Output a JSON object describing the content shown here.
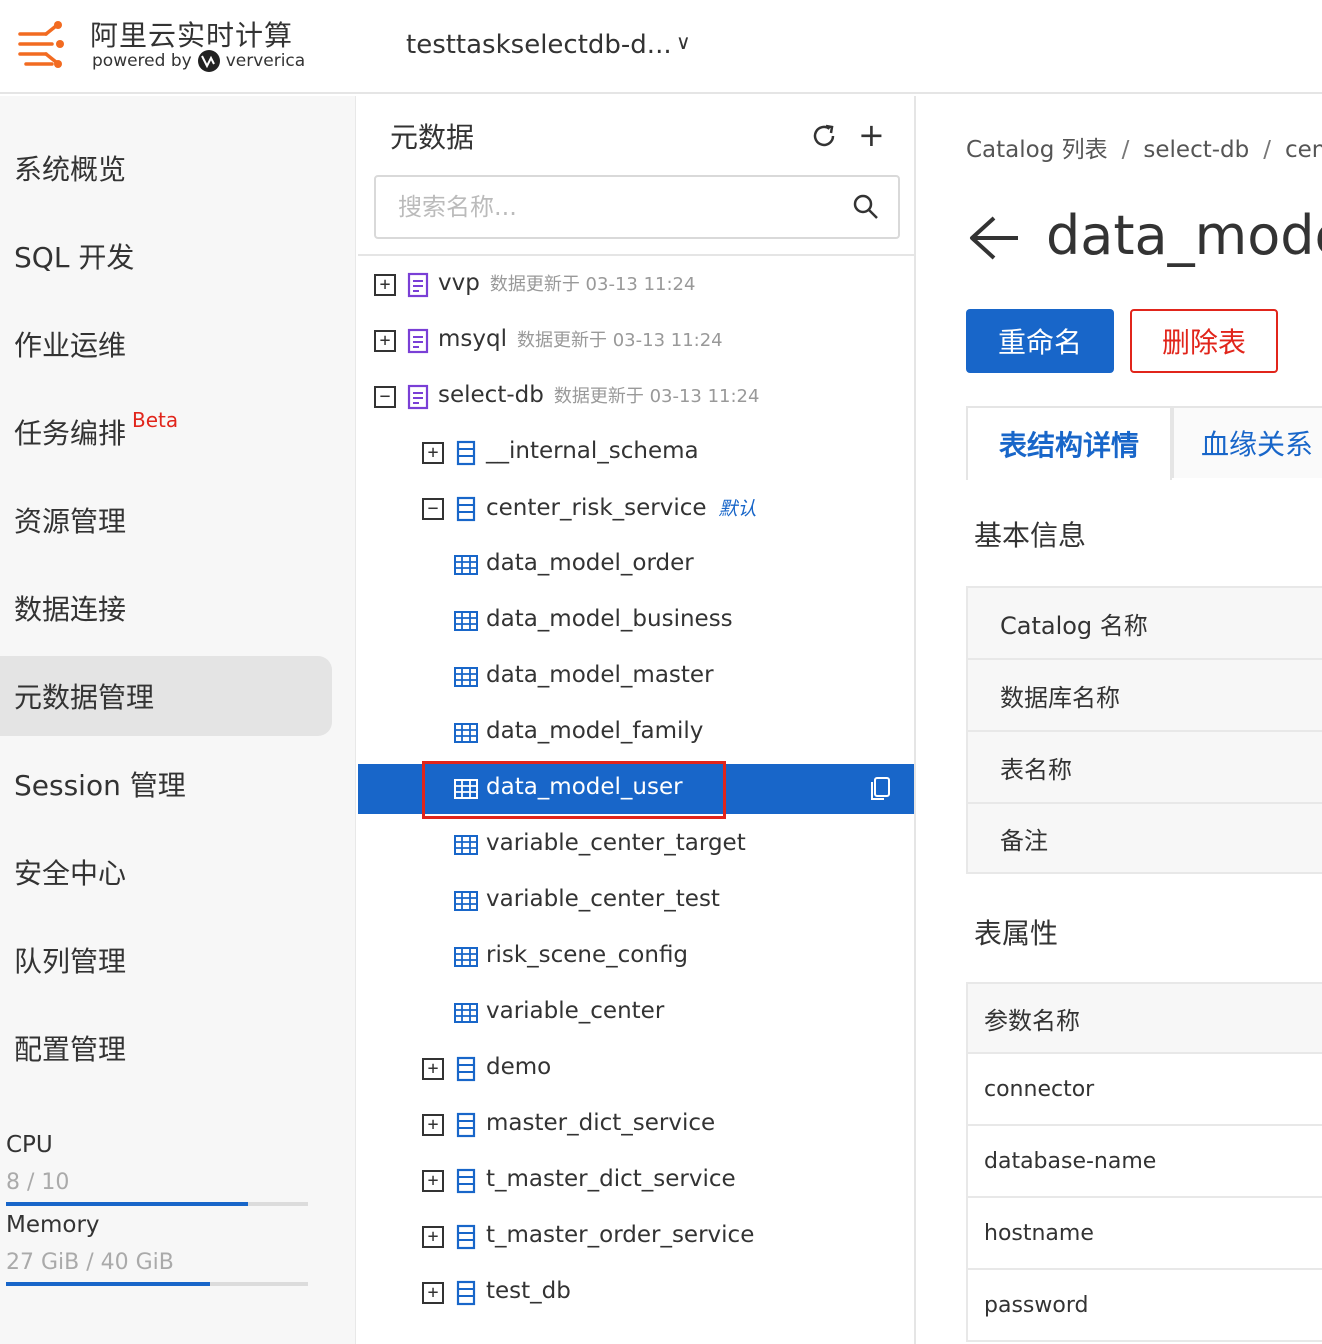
{
  "header": {
    "brand_title": "阿里云实时计算",
    "powered_by": "powered by",
    "partner": "ververica",
    "workspace": "testtaskselectdb-d...",
    "chevron": "∨"
  },
  "nav": {
    "items": [
      {
        "label": "系统概览"
      },
      {
        "label": "SQL 开发"
      },
      {
        "label": "作业运维"
      },
      {
        "label": "任务编排",
        "badge": "Beta"
      },
      {
        "label": "资源管理"
      },
      {
        "label": "数据连接"
      },
      {
        "label": "元数据管理",
        "active": true
      },
      {
        "label": "Session 管理"
      },
      {
        "label": "安全中心"
      },
      {
        "label": "队列管理"
      },
      {
        "label": "配置管理"
      }
    ],
    "resources": {
      "cpu_label": "CPU",
      "cpu_value": "8 / 10",
      "cpu_ratio": 0.8,
      "memory_label": "Memory",
      "memory_value": "27 GiB / 40 GiB",
      "memory_ratio": 0.675
    }
  },
  "tree": {
    "title": "元数据",
    "search_placeholder": "搜索名称...",
    "catalogs": [
      {
        "name": "vvp",
        "meta": "数据更新于 03-13 11:24",
        "expander": "+"
      },
      {
        "name": "msyql",
        "meta": "数据更新于 03-13 11:24",
        "expander": "+"
      },
      {
        "name": "select-db",
        "meta": "数据更新于 03-13 11:24",
        "expander": "−"
      }
    ],
    "databases_before": [
      {
        "name": "__internal_schema",
        "expander": "+"
      },
      {
        "name": "center_risk_service",
        "expander": "−",
        "tag": "默认"
      }
    ],
    "tables": [
      {
        "name": "data_model_order"
      },
      {
        "name": "data_model_business"
      },
      {
        "name": "data_model_master"
      },
      {
        "name": "data_model_family"
      },
      {
        "name": "data_model_user",
        "selected": true
      },
      {
        "name": "variable_center_target"
      },
      {
        "name": "variable_center_test"
      },
      {
        "name": "risk_scene_config"
      },
      {
        "name": "variable_center"
      }
    ],
    "databases_after": [
      {
        "name": "demo",
        "expander": "+"
      },
      {
        "name": "master_dict_service",
        "expander": "+"
      },
      {
        "name": "t_master_dict_service",
        "expander": "+"
      },
      {
        "name": "t_master_order_service",
        "expander": "+"
      },
      {
        "name": "test_db",
        "expander": "+"
      }
    ]
  },
  "details": {
    "breadcrumb": [
      "Catalog 列表",
      "select-db",
      "cent"
    ],
    "breadcrumb_sep": "/",
    "title": "data_mode",
    "rename_label": "重命名",
    "delete_label": "删除表",
    "tabs": [
      "表结构详情",
      "血缘关系"
    ],
    "basic_info_title": "基本信息",
    "basic_info_rows": [
      "Catalog 名称",
      "数据库名称",
      "表名称",
      "备注"
    ],
    "props_title": "表属性",
    "props_header": "参数名称",
    "props_rows": [
      "connector",
      "database-name",
      "hostname",
      "password"
    ]
  },
  "colors": {
    "accent": "#1866c9",
    "danger": "#e1251b",
    "brand_orange": "#f26b21",
    "catalog_icon": "#7a3fd6"
  }
}
